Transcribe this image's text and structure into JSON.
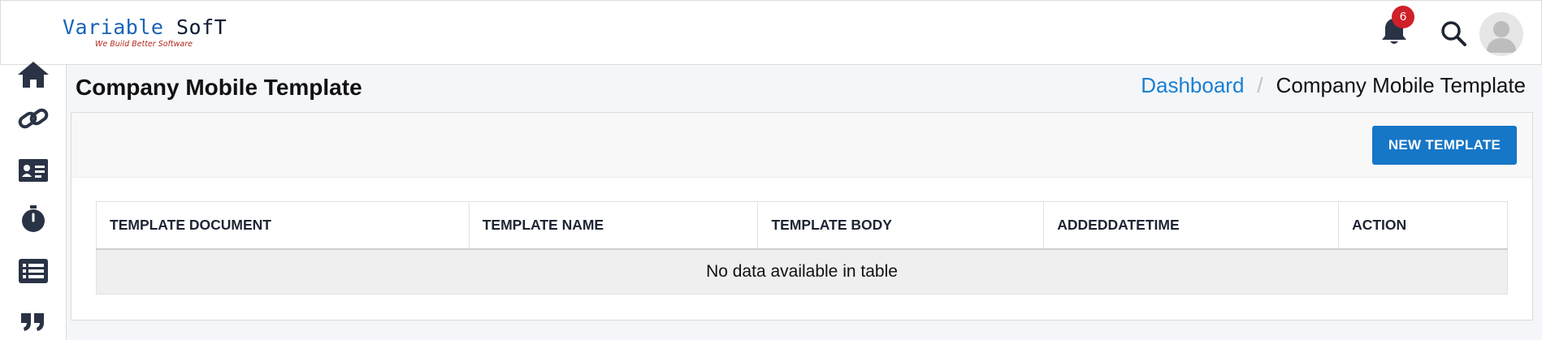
{
  "brand": {
    "name_part1": "Variable ",
    "name_part2": "SofT",
    "tagline": "We Build Better Software"
  },
  "header": {
    "notification_count": "6"
  },
  "sidebar": {
    "items": [
      {
        "icon": "home-icon"
      },
      {
        "icon": "link-icon"
      },
      {
        "icon": "id-card-icon"
      },
      {
        "icon": "stopwatch-icon"
      },
      {
        "icon": "list-icon"
      },
      {
        "icon": "quote-icon"
      }
    ]
  },
  "page": {
    "title": "Company Mobile Template"
  },
  "breadcrumb": {
    "home": "Dashboard",
    "separator": "/",
    "current": "Company Mobile Template"
  },
  "toolbar": {
    "new_template_label": "NEW TEMPLATE"
  },
  "table": {
    "columns": [
      "TEMPLATE DOCUMENT",
      "TEMPLATE NAME",
      "TEMPLATE BODY",
      "ADDEDDATETIME",
      "ACTION"
    ],
    "empty_message": "No data available in table"
  },
  "colors": {
    "primary": "#1676c7",
    "link": "#1b7fd1",
    "badge": "#d0202a",
    "icon": "#2a3345"
  }
}
